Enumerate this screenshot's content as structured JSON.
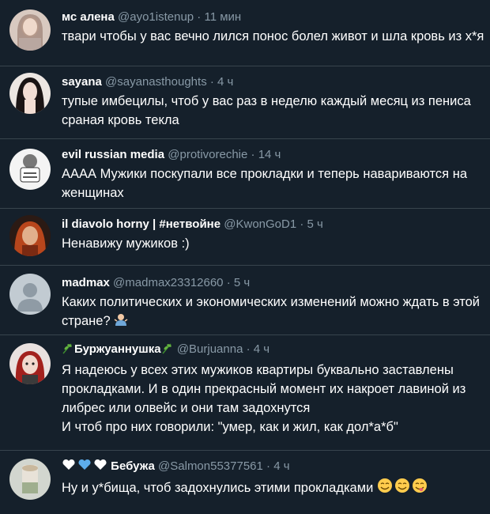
{
  "tweets": [
    {
      "name": "мс алена",
      "handle": "@ayo1istenup",
      "separator": "·",
      "time": "11 мин",
      "text": "твари чтобы у вас вечно лился понос болел живот и шла кровь из х*я"
    },
    {
      "name": "sayana",
      "handle": "@sayanasthoughts",
      "separator": "·",
      "time": "4 ч",
      "text": "тупые имбецилы, чтоб у вас раз в неделю каждый месяц из пениса сраная кровь текла"
    },
    {
      "name": "evil russian media",
      "handle": "@protivorechie",
      "separator": "·",
      "time": "14 ч",
      "text": "АААА Мужики поскупали все прокладки и теперь навариваются на женщинах"
    },
    {
      "name": "il diavolo horny | #нетвойне",
      "handle": "@KwonGoD1",
      "separator": "·",
      "time": "5 ч",
      "text": "Ненавижу мужиков :)"
    },
    {
      "name": "madmax",
      "handle": "@madmax23312660",
      "separator": "·",
      "time": "5 ч",
      "text": "Каких политических и экономических изменений можно ждать в этой стране?"
    },
    {
      "name": "Буржуаннушка",
      "handle": "@Burjuanna",
      "separator": "·",
      "time": "4 ч",
      "text": "Я надеюсь у всех этих мужиков квартиры буквально заставлены прокладками. И в один прекрасный момент их накроет лавиной из либрес или олвейс и они там задохнутся",
      "text2": "И чтоб про них говорили: \"умер, как и жил, как дол*а*б\""
    },
    {
      "name": "Бебужа",
      "handle": "@Salmon55377561",
      "separator": "·",
      "time": "4 ч",
      "text": "Ну и у*бища, чтоб задохнулись этими прокладками"
    }
  ],
  "icons": {
    "madmax_emoji": "person-shrugging-icon",
    "burjuanna_emoji": "herb-icon",
    "bebuzha_emoji": "hearts-icon",
    "bebuzha_trailing_emoji": "smiling-face-icon"
  },
  "colors": {
    "background": "#15202b",
    "divider": "#38444d",
    "secondary_text": "#8899a6",
    "primary_text": "#ffffff"
  }
}
